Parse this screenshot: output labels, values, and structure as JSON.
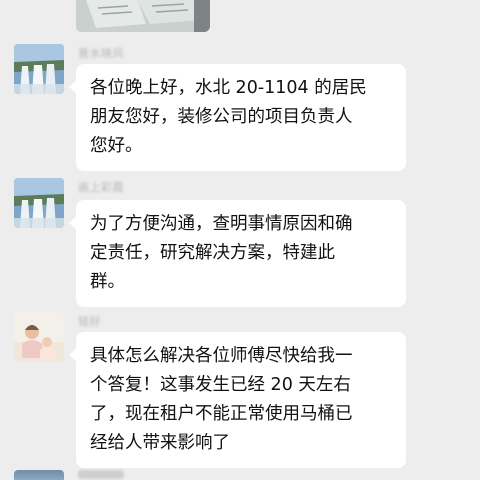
{
  "messages": [
    {
      "sender": "晋水晓风",
      "avatar": "waterfall-avatar",
      "lines": [
        "各位晚上好，水北 20-1104 的居民",
        "朋友您好，装修公司的项目负责人",
        "您好。"
      ]
    },
    {
      "sender": "画上彩霞",
      "avatar": "waterfall-avatar",
      "lines": [
        "为了方便沟通，查明事情原因和确",
        "定责任，研究解决方案，特建此",
        "群。"
      ]
    },
    {
      "sender": "铭好",
      "avatar": "family-photo-avatar",
      "lines": [
        "具体怎么解决各位师傅尽快给我一",
        "个答复！这事发生已经 20 天左右",
        "了，现在租户不能正常使用马桶已",
        "经给人带来影响了"
      ]
    }
  ],
  "colors": {
    "background": "#ededed",
    "bubble": "#ffffff",
    "text": "#111111",
    "sender": "#b6b6b6"
  }
}
